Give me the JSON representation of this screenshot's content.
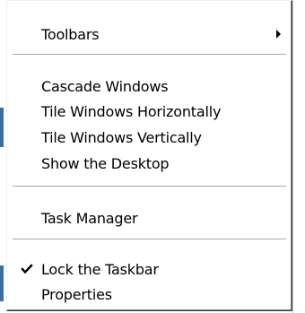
{
  "menu": {
    "items": [
      {
        "label": "Toolbars",
        "has_submenu": true
      },
      {
        "label": "Cascade Windows"
      },
      {
        "label": "Tile Windows Horizontally"
      },
      {
        "label": "Tile Windows Vertically"
      },
      {
        "label": "Show the Desktop"
      },
      {
        "label": "Task Manager"
      },
      {
        "label": "Lock the Taskbar",
        "checked": true
      },
      {
        "label": "Properties"
      }
    ],
    "submenu_arrow_icon": "triangle-right-icon",
    "check_icon": "checkmark-icon"
  }
}
